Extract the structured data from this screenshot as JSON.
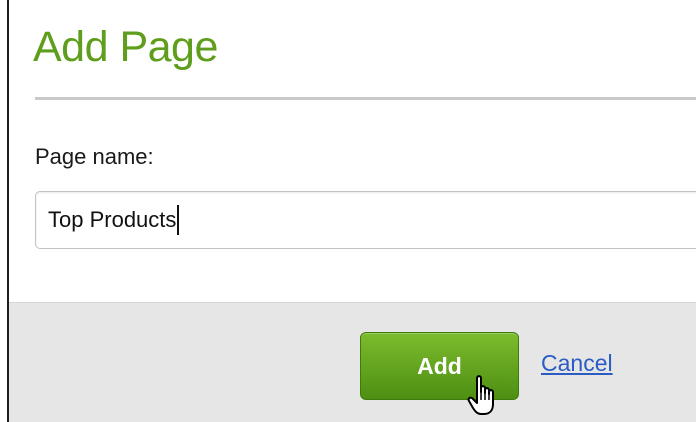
{
  "dialog": {
    "title": "Add Page",
    "field_label": "Page name:",
    "field_value": "Top Products"
  },
  "footer": {
    "add_label": "Add",
    "cancel_label": "Cancel"
  },
  "colors": {
    "title": "#5f9e1c",
    "button_top": "#7cbc2e",
    "button_bottom": "#4d8f12",
    "link": "#2a5cc4",
    "footer_bg": "#e6e6e6"
  },
  "icons": {
    "cursor": "hand-pointer-icon"
  }
}
